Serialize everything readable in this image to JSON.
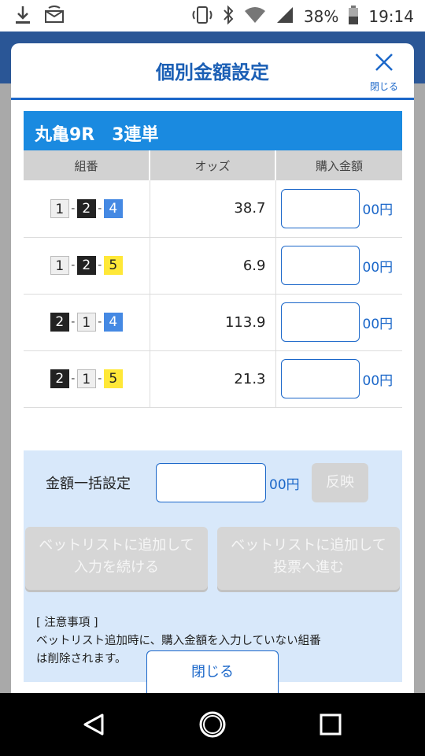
{
  "status_bar": {
    "battery": "38%",
    "time": "19:14",
    "icons": [
      "download-icon",
      "sim-card-icon",
      "nfc-icon",
      "bluetooth-icon",
      "wifi-icon",
      "signal-icon",
      "battery-icon"
    ]
  },
  "dialog": {
    "title": "個別金額設定",
    "close_label": "閉じる",
    "race_label": "丸亀9R　3連単",
    "table": {
      "headers": [
        "組番",
        "オッズ",
        "購入金額"
      ],
      "rows": [
        {
          "combo": [
            "1",
            "2",
            "4"
          ],
          "odds": "38.7",
          "unit": "00円"
        },
        {
          "combo": [
            "1",
            "2",
            "5"
          ],
          "odds": "6.9",
          "unit": "00円"
        },
        {
          "combo": [
            "2",
            "1",
            "4"
          ],
          "odds": "113.9",
          "unit": "00円"
        },
        {
          "combo": [
            "2",
            "1",
            "5"
          ],
          "odds": "21.3",
          "unit": "00円"
        }
      ]
    },
    "bulk": {
      "label": "金額一括設定",
      "unit": "00円",
      "reflect_label": "反映"
    },
    "actions": {
      "add_continue_line1": "ベットリストに追加して",
      "add_continue_line2": "入力を続ける",
      "add_vote_line1": "ベットリストに追加して",
      "add_vote_line2": "投票へ進む"
    },
    "notice": {
      "heading": "[ 注意事項 ]",
      "line1": "ベットリスト追加時に、購入金額を入力していない組番",
      "line2": "は削除されます。"
    },
    "footer_close": "閉じる"
  },
  "colors": {
    "accent": "#1b67c9",
    "race_bar": "#1a8ae0",
    "panel_bg": "#d8e8fa",
    "boat1": "#efefef",
    "boat2": "#222222",
    "boat4": "#4589e3",
    "boat5": "#ffe838"
  }
}
